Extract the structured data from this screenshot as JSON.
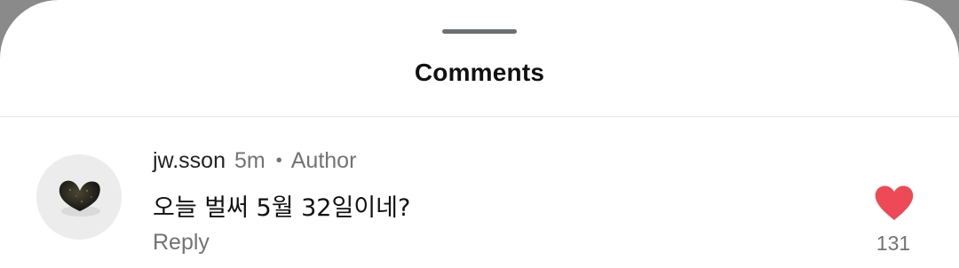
{
  "sheet": {
    "title": "Comments"
  },
  "comment": {
    "username": "jw.sson",
    "time": "5m",
    "separator": "•",
    "badge": "Author",
    "text": "오늘 벌써 5월 32일이네?",
    "reply_label": "Reply",
    "like_count": "131",
    "liked": true,
    "like_color": "#ed4956"
  },
  "colors": {
    "background_dim": "#8a8a8a",
    "sheet": "#ffffff",
    "secondary_text": "#737373",
    "primary_text": "#111111"
  }
}
